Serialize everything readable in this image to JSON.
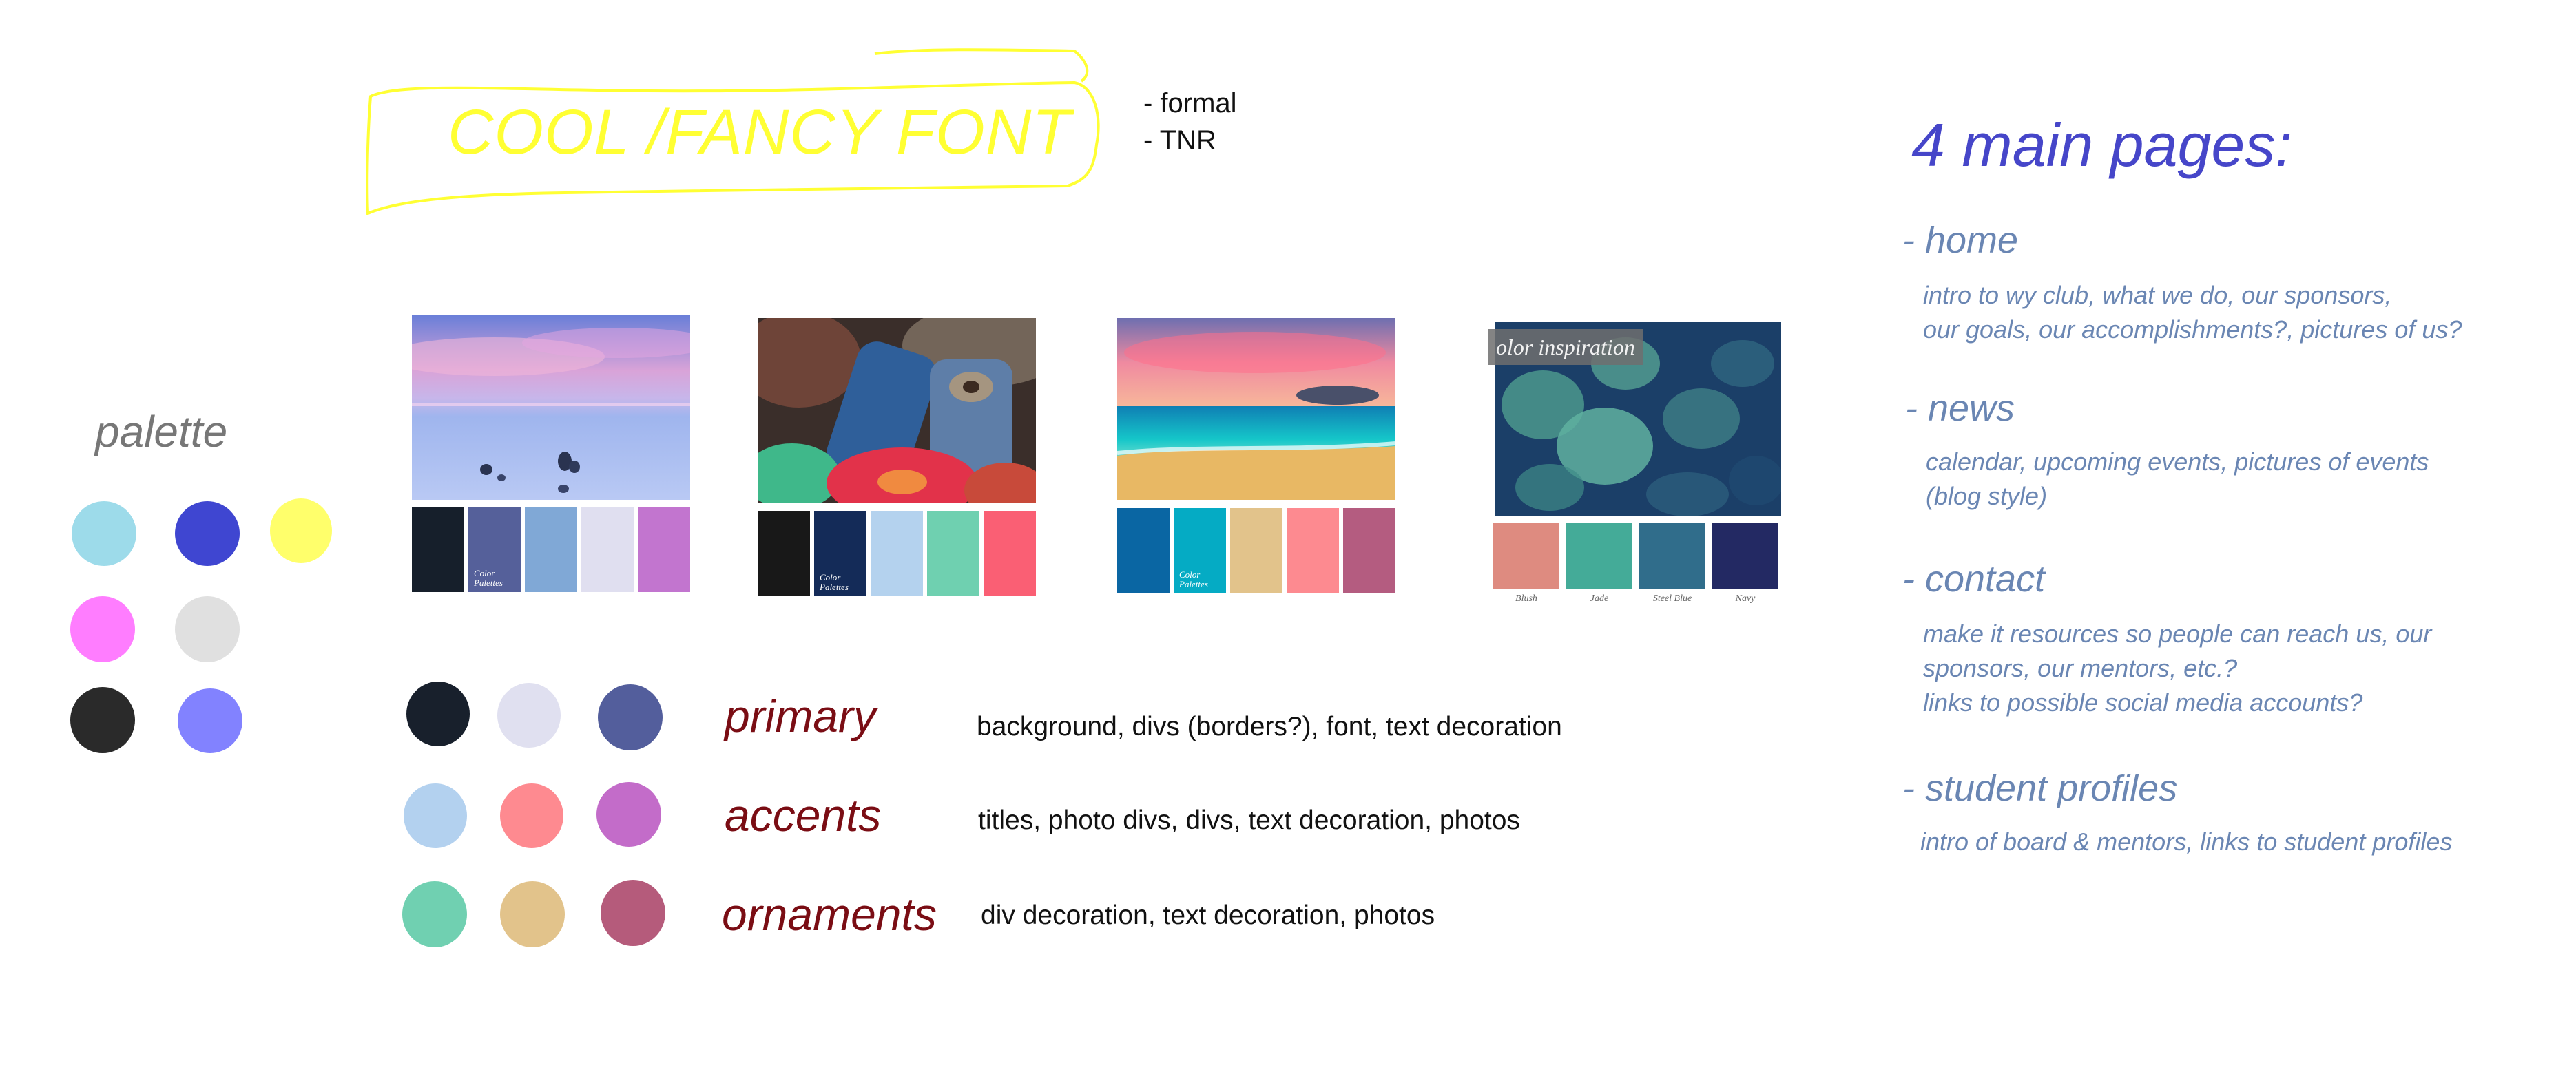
{
  "title": {
    "text": "COOL /FANCY FONT",
    "notes": [
      "- formal",
      "- TNR"
    ]
  },
  "palette": {
    "label": "palette",
    "colors": [
      "#9ddbea",
      "#3f46d1",
      "#ffff6b",
      "#ff7dff",
      "#e0e0e0",
      "#2a2a2a",
      "#8282ff"
    ]
  },
  "images": [
    {
      "swatches": [
        "#161f2b",
        "#55609a",
        "#80a8d6",
        "#e0dff0",
        "#c275cf"
      ],
      "captions": [
        "",
        "Color Palettes",
        "",
        "",
        ""
      ]
    },
    {
      "swatches": [
        "#181818",
        "#142b58",
        "#b4d2ee",
        "#6fd0b0",
        "#fa5f74"
      ],
      "captions": [
        "",
        "Color Palettes",
        "",
        "",
        ""
      ]
    },
    {
      "swatches": [
        "#0a66a3",
        "#05abc4",
        "#e2c38b",
        "#fd8a90",
        "#b45c80"
      ],
      "captions": [
        "",
        "Color Palettes",
        "",
        "",
        ""
      ]
    },
    {
      "badge": "olor inspiration",
      "swatches": [
        "#de8b80",
        "#44ab98",
        "#306d8b",
        "#232963"
      ],
      "labels": [
        "Blush",
        "Jade",
        "Steel Blue",
        "Navy"
      ]
    }
  ],
  "categories": [
    {
      "name": "primary",
      "colors": [
        "#18202c",
        "#e0e0f0",
        "#535e9c"
      ],
      "description": "background, divs (borders?), font, text decoration"
    },
    {
      "name": "accents",
      "colors": [
        "#b3d1ef",
        "#fe8a90",
        "#c36cc9"
      ],
      "description": "titles, photo divs, divs, text decoration, photos"
    },
    {
      "name": "ornaments",
      "colors": [
        "#70d0b1",
        "#e2c38b",
        "#b55b7b"
      ],
      "description": "div decoration, text decoration, photos"
    }
  ],
  "pages": {
    "title": "4 main pages:",
    "items": [
      {
        "heading": "- home",
        "lines": [
          "intro to wy club, what we do, our sponsors,",
          "our goals, our accomplishments?, pictures of us?"
        ]
      },
      {
        "heading": "- news",
        "lines": [
          "calendar, upcoming events, pictures of events",
          "(blog style)"
        ]
      },
      {
        "heading": "- contact",
        "lines": [
          "make it resources so people can reach us, our",
          "sponsors, our mentors, etc.?",
          "links to possible social media accounts?"
        ]
      },
      {
        "heading": "- student profiles",
        "lines": [
          "intro of board & mentors, links to student profiles"
        ]
      }
    ]
  },
  "accent_colors": {
    "title_yellow": "#ffff33",
    "category_red": "#7a0d14",
    "pages_title_blue": "#4646c9",
    "pages_text_blue": "#6a86b3"
  }
}
